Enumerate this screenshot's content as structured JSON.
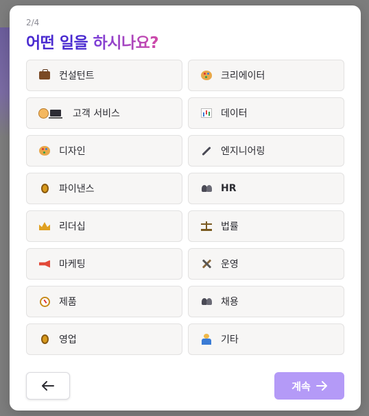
{
  "step": "2/4",
  "title": {
    "prefix": "어떤 일을",
    "accent": "하시나요?"
  },
  "options": [
    {
      "label": "컨설턴트",
      "icon": "briefcase-icon"
    },
    {
      "label": "크리에이터",
      "icon": "artist-palette-icon"
    },
    {
      "label": "고객 서비스",
      "icon": "person-laptop-icon"
    },
    {
      "label": "데이터",
      "icon": "bar-chart-icon"
    },
    {
      "label": "디자인",
      "icon": "artist-palette-icon"
    },
    {
      "label": "엔지니어링",
      "icon": "wrench-icon"
    },
    {
      "label": "파이낸스",
      "icon": "medal-icon"
    },
    {
      "label": "HR",
      "icon": "people-icon"
    },
    {
      "label": "리더십",
      "icon": "crown-icon"
    },
    {
      "label": "법률",
      "icon": "balance-scale-icon"
    },
    {
      "label": "마케팅",
      "icon": "megaphone-icon"
    },
    {
      "label": "운영",
      "icon": "hammer-wrench-icon"
    },
    {
      "label": "제품",
      "icon": "compass-icon"
    },
    {
      "label": "채용",
      "icon": "people-icon"
    },
    {
      "label": "영업",
      "icon": "medal-icon"
    },
    {
      "label": "기타",
      "icon": "person-raising-hands-icon"
    }
  ],
  "buttons": {
    "back_icon": "arrow-left-icon",
    "continue_label": "계속",
    "continue_icon": "arrow-right-icon"
  },
  "colors": {
    "title": "#4a2bd0",
    "accent_gradient_start": "#7a3fd8",
    "accent_gradient_end": "#d04aa8",
    "continue_button": "#b49af7",
    "option_background": "#f7f6f5"
  }
}
